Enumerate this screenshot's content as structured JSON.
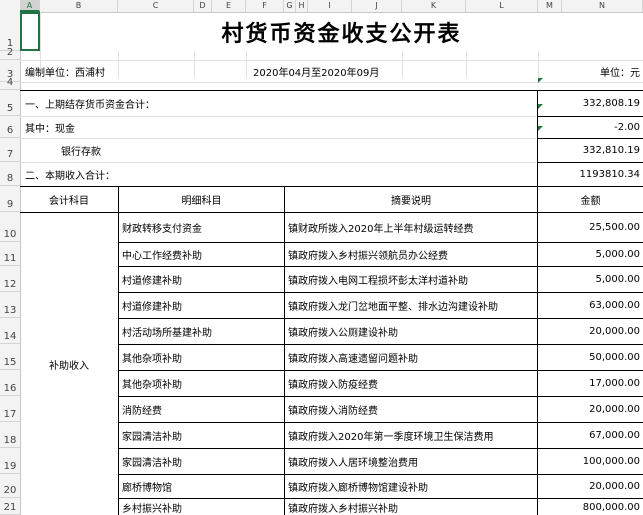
{
  "sheet": {
    "columns": [
      "A",
      "B",
      "C",
      "D",
      "E",
      "F",
      "G",
      "H",
      "I",
      "J",
      "K",
      "L",
      "M",
      "N"
    ],
    "rows": [
      "1",
      "2",
      "3",
      "4",
      "5",
      "6",
      "7",
      "8",
      "9",
      "10",
      "11",
      "12",
      "13",
      "14",
      "15",
      "16",
      "17",
      "18",
      "19",
      "20",
      "21"
    ],
    "selected_cell": "A1"
  },
  "report": {
    "title": "村货币资金收支公开表",
    "unit_label": "编制单位：西浦村",
    "period": "2020年04月至2020年09月",
    "currency_label": "单位：元"
  },
  "summary": {
    "prev_total_label": "一、上期结存货币资金合计：",
    "prev_total_value": "332,808.19",
    "cash_label": "其中：现金",
    "cash_value": "-2.00",
    "bank_label": "银行存款",
    "bank_value": "332,810.19",
    "income_total_label": "二、本期收入合计：",
    "income_total_value": "1193810.34"
  },
  "table": {
    "headers": [
      "会计科目",
      "明细科目",
      "摘要说明",
      "金额"
    ],
    "category": "补助收入",
    "rows": [
      {
        "detail": "财政转移支付资金",
        "summary": "镇财政所拨入2020年上半年村级运转经费",
        "amount": "25,500.00"
      },
      {
        "detail": "中心工作经费补助",
        "summary": "镇政府拨入乡村振兴领航员办公经费",
        "amount": "5,000.00"
      },
      {
        "detail": "村道修建补助",
        "summary": "镇政府拨入电网工程损坏彭太洋村道补助",
        "amount": "5,000.00"
      },
      {
        "detail": "村道修建补助",
        "summary": "镇政府拨入龙门岔地面平整、排水边沟建设补助",
        "amount": "63,000.00"
      },
      {
        "detail": "村活动场所基建补助",
        "summary": "镇政府拨入公厕建设补助",
        "amount": "20,000.00"
      },
      {
        "detail": "其他杂项补助",
        "summary": "镇政府拨入高速遗留问题补助",
        "amount": "50,000.00"
      },
      {
        "detail": "其他杂项补助",
        "summary": "镇政府拨入防疫经费",
        "amount": "17,000.00"
      },
      {
        "detail": "消防经费",
        "summary": "镇政府拨入消防经费",
        "amount": "20,000.00"
      },
      {
        "detail": "家园清洁补助",
        "summary": "镇政府拨入2020年第一季度环境卫生保洁费用",
        "amount": "67,000.00"
      },
      {
        "detail": "家园清洁补助",
        "summary": "镇政府拨入人居环境整治费用",
        "amount": "100,000.00"
      },
      {
        "detail": "廊桥博物馆",
        "summary": "镇政府拨入廊桥博物馆建设补助",
        "amount": "20,000.00"
      },
      {
        "detail": "乡村振兴补助",
        "summary": "镇政府拨入乡村振兴补助",
        "amount": "800,000.00"
      }
    ]
  }
}
